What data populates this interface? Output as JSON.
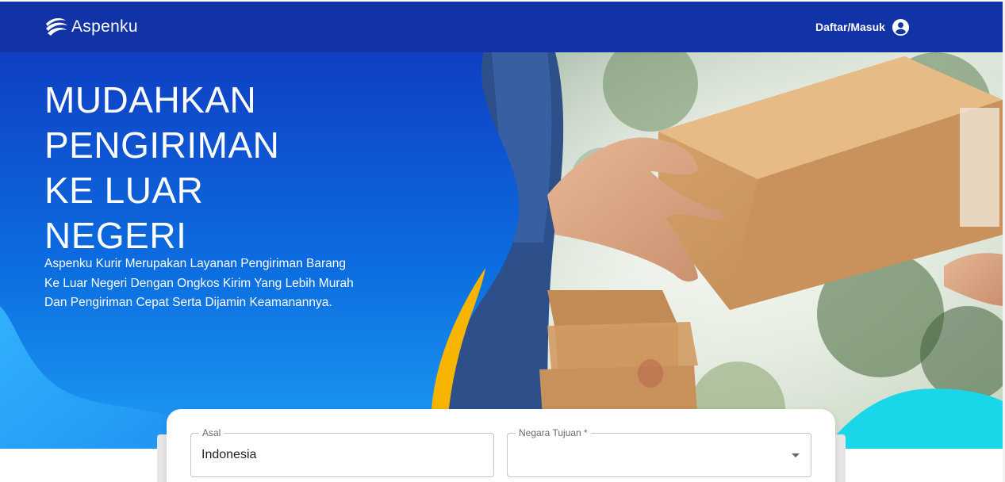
{
  "header": {
    "brand_name": "Aspenku",
    "login_label": "Daftar/Masuk",
    "account_icon": "account-circle-icon",
    "brand_icon": "aspenku-logo-icon",
    "background_color": "#1233a6"
  },
  "hero": {
    "title_lines": [
      "MUDAHKAN",
      "PENGIRIMAN",
      "KE LUAR",
      "NEGERI"
    ],
    "description_lines": [
      "Aspenku Kurir Merupakan Layanan Pengiriman Barang",
      "Ke Luar Negeri Dengan Ongkos Kirim Yang Lebih Murah",
      "Dan Pengiriman Cepat Serta Dijamin Keamanannya."
    ],
    "gradient_top_color": "#1040c6",
    "gradient_bottom_color": "#2aa8f5",
    "accent_yellow": "#f7b500",
    "accent_cyan": "#19d6e8"
  },
  "form": {
    "origin_label": "Asal",
    "origin_value": "Indonesia",
    "destination_label": "Negara Tujuan *",
    "destination_value": "",
    "destination_icon": "chevron-down-icon"
  }
}
